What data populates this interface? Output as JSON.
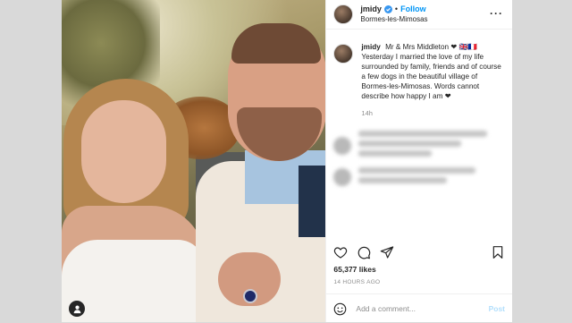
{
  "post": {
    "username": "jmidy",
    "follow_label": "Follow",
    "separator": "•",
    "location": "Bormes-les-Mimosas",
    "more_label": "···"
  },
  "caption": {
    "username": "jmidy",
    "first_line": "Mr & Mrs Middleton ❤ 🇬🇧🇫🇷",
    "text": "Yesterday I married the love of my life surrounded by family, friends and of course a few dogs in the beautiful village of Bormes-les-Mimosas. Words cannot describe how happy I am ❤",
    "age": "14h"
  },
  "stats": {
    "likes": "65,377 likes",
    "time_ago": "14 HOURS AGO"
  },
  "comment": {
    "placeholder": "Add a comment...",
    "post_label": "Post"
  },
  "icons": {
    "verified": "verified-badge-icon",
    "like": "heart-icon",
    "comment": "comment-bubble-icon",
    "share": "paper-plane-icon",
    "save": "bookmark-icon",
    "emoji": "smiley-icon",
    "tagged": "user-tag-icon"
  },
  "colors": {
    "accent": "#0095f6",
    "verified": "#3897f0",
    "text": "#262626",
    "muted": "#8e8e8e"
  }
}
